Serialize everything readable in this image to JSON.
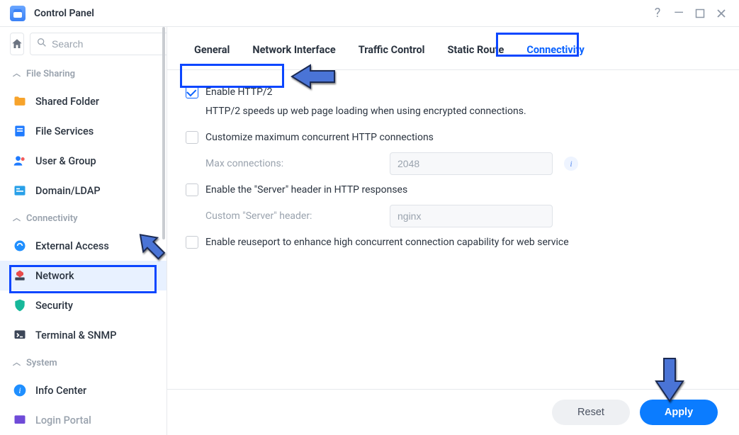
{
  "window": {
    "title": "Control Panel"
  },
  "search": {
    "placeholder": "Search"
  },
  "sidebar": {
    "sections": {
      "file_sharing": "File Sharing",
      "connectivity": "Connectivity",
      "system": "System"
    },
    "items": {
      "shared_folder": "Shared Folder",
      "file_services": "File Services",
      "user_group": "User & Group",
      "domain_ldap": "Domain/LDAP",
      "external_access": "External Access",
      "network": "Network",
      "security": "Security",
      "terminal_snmp": "Terminal & SNMP",
      "info_center": "Info Center",
      "login_portal": "Login Portal"
    }
  },
  "tabs": {
    "general": "General",
    "network_interface": "Network Interface",
    "traffic_control": "Traffic Control",
    "static_route": "Static Route",
    "connectivity": "Connectivity"
  },
  "form": {
    "enable_http2": "Enable HTTP/2",
    "http2_desc": "HTTP/2 speeds up web page loading when using encrypted connections.",
    "customize_max": "Customize maximum concurrent HTTP connections",
    "max_conn_label": "Max connections:",
    "max_conn_value": "2048",
    "enable_server_header": "Enable the \"Server\" header in HTTP responses",
    "custom_header_label": "Custom \"Server\" header:",
    "custom_header_value": "nginx",
    "enable_reuseport": "Enable reuseport to enhance high concurrent connection capability for web service"
  },
  "footer": {
    "reset": "Reset",
    "apply": "Apply"
  },
  "colors": {
    "accent": "#0b63ff",
    "highlight": "#0b46ff"
  }
}
